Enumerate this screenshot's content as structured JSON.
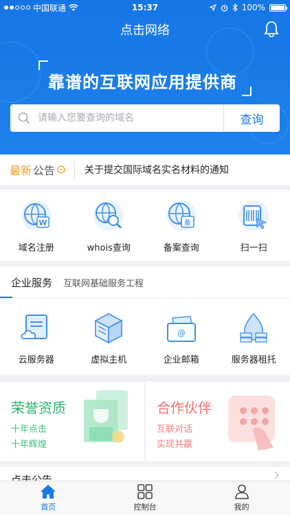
{
  "status_bar": {
    "carrier": "中国联通",
    "time": "15:37",
    "battery": "100%",
    "battery_level": 1.0
  },
  "header": {
    "title": "点击网络",
    "slogan": "靠谱的互联网应用提供商"
  },
  "search": {
    "placeholder": "请输入您要查询的域名",
    "button_label": "查询"
  },
  "notice": {
    "tag_part1": "最新",
    "tag_part2": "公告",
    "text": "关于提交国际域名实名材料的通知"
  },
  "tools": [
    {
      "label": "域名注册",
      "icon": "domain-register-icon"
    },
    {
      "label": "whois查询",
      "icon": "whois-search-icon"
    },
    {
      "label": "备案查询",
      "icon": "icp-record-icon"
    },
    {
      "label": "扫一扫",
      "icon": "scan-icon"
    }
  ],
  "services": {
    "title": "企业服务",
    "subtitle": "互联网基础服务工程",
    "items": [
      {
        "label": "云服务器",
        "icon": "cloud-server-icon"
      },
      {
        "label": "虚拟主机",
        "icon": "virtual-host-icon"
      },
      {
        "label": "企业邮箱",
        "icon": "enterprise-mail-icon"
      },
      {
        "label": "服务器租托",
        "icon": "server-hosting-icon"
      }
    ]
  },
  "promos": [
    {
      "title": "荣誉资质",
      "line1": "十年点击",
      "line2": "十年辉煌"
    },
    {
      "title": "合作伙伴",
      "line1": "互联对话",
      "line2": "实现共赢"
    }
  ],
  "section_peek": "点击公告",
  "tabbar": [
    {
      "label": "首页",
      "icon": "home-icon",
      "active": true
    },
    {
      "label": "控制台",
      "icon": "grid-icon",
      "active": false
    },
    {
      "label": "我的",
      "icon": "user-icon",
      "active": false
    }
  ],
  "colors": {
    "brand_blue": "#1a78e6",
    "notice_orange": "#f0a020",
    "honor_green": "#28b56b",
    "partner_red": "#ef6f6f"
  }
}
